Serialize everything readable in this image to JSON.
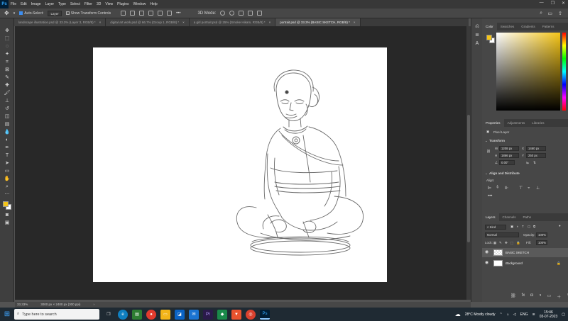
{
  "menubar": {
    "logo": "Ps",
    "items": [
      "File",
      "Edit",
      "Image",
      "Layer",
      "Type",
      "Select",
      "Filter",
      "3D",
      "View",
      "Plugins",
      "Window",
      "Help"
    ],
    "window_controls": [
      "—",
      "❐",
      "✕"
    ]
  },
  "optionsbar": {
    "auto_select_label": "Auto-Select:",
    "auto_select_value": "Layer",
    "show_transform_label": "Show Transform Controls"
  },
  "tabs": [
    {
      "label": "landscape illustration.psd @ 33.3% (Layer 3, RGB/8) *",
      "active": false
    },
    {
      "label": "digital art work.psd @ 66.7% (Group 1, RGB/8) *",
      "active": false
    },
    {
      "label": "a girl portrait.psd @ 25% (Smoke Hikam, RGB/8) *",
      "active": false
    },
    {
      "label": "portrait.psd @ 33.3% (BASIC SKETCH, RGB/8) *",
      "active": true
    }
  ],
  "tab_close": "×",
  "status": {
    "zoom": "33.33%",
    "doc_size": "3000 px × 2400 px (300 ppi)"
  },
  "color_panel": {
    "tabs": [
      "Color",
      "Swatches",
      "Gradients",
      "Patterns"
    ],
    "fg_color": "#f5c518",
    "bg_color": "#ffffff"
  },
  "properties_panel": {
    "tabs": [
      "Properties",
      "Adjustments",
      "Libraries"
    ],
    "layer_type": "Pixel Layer",
    "transform_heading": "Transform",
    "w_label": "W",
    "w_value": "1208 px",
    "h_label": "H",
    "h_value": "1866 px",
    "x_label": "X",
    "x_value": "1460 px",
    "y_label": "Y",
    "y_value": "250 px",
    "angle_value": "0.00°",
    "align_heading": "Align and Distribute",
    "align_label": "Align:"
  },
  "layers_panel": {
    "tabs": [
      "Layers",
      "Channels",
      "Paths"
    ],
    "kind_label": "Kind",
    "blend_mode": "Normal",
    "opacity_label": "Opacity:",
    "opacity_value": "100%",
    "lock_label": "Lock:",
    "fill_label": "Fill:",
    "fill_value": "100%",
    "layers": [
      {
        "name": "BASIC SKETCH",
        "selected": true
      },
      {
        "name": "Background",
        "selected": false
      }
    ]
  },
  "taskbar": {
    "search_placeholder": "Type here to search",
    "weather": "28°C  Mostly cloudy",
    "lang": "ENG",
    "time": "15:46",
    "date": "03-07-2023"
  }
}
